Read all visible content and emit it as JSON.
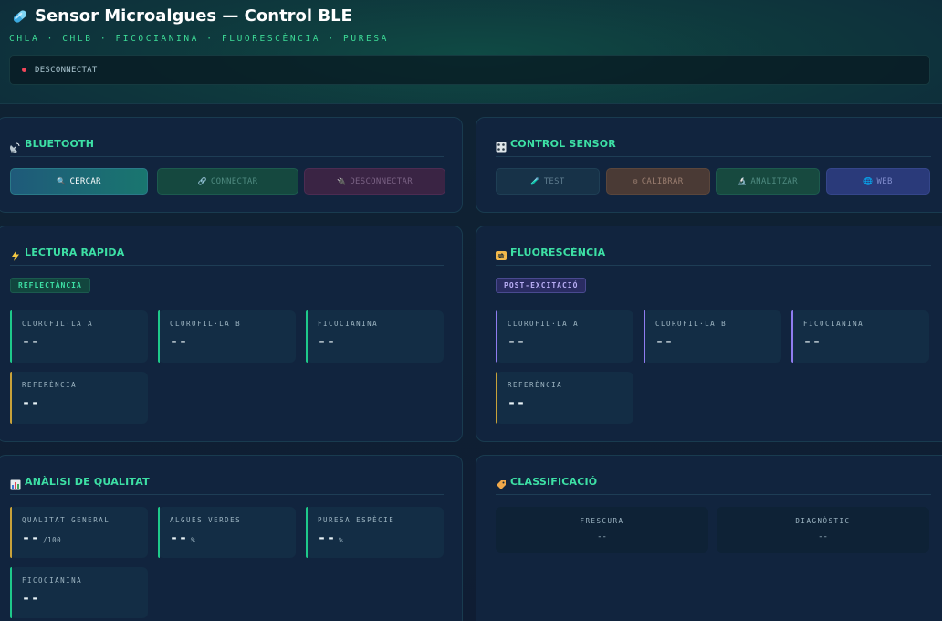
{
  "header": {
    "title": "Sensor Microalgues — Control BLE",
    "subtitle": "CHLA · CHLB · FICOCIANINA · FLUORESCÈNCIA · PURESA",
    "status": "DESCONNECTAT",
    "status_color": "#f0465a"
  },
  "bluetooth": {
    "title": "BLUETOOTH",
    "icon": "satellite-antenna-icon",
    "buttons": {
      "search": {
        "label": "CERCAR",
        "icon": "magnifier-icon"
      },
      "connect": {
        "label": "CONNECTAR",
        "icon": "link-icon"
      },
      "disconnect": {
        "label": "DESCONNECTAR",
        "icon": "unplug-icon"
      }
    }
  },
  "control": {
    "title": "CONTROL SENSOR",
    "icon": "control-knobs-icon",
    "buttons": {
      "test": {
        "label": "TEST",
        "icon": "test-tube-icon"
      },
      "calibrate": {
        "label": "CALIBRAR",
        "icon": "gear-icon"
      },
      "analyze": {
        "label": "ANALITZAR",
        "icon": "microscope-icon"
      },
      "web": {
        "label": "WEB",
        "icon": "globe-icon"
      }
    }
  },
  "quick": {
    "title": "LECTURA RÀPIDA",
    "icon": "lightning-icon",
    "tag": "REFLECTÀNCIA",
    "metrics": [
      {
        "label": "CLOROFIL·LA A",
        "value": "--"
      },
      {
        "label": "CLOROFIL·LA B",
        "value": "--"
      },
      {
        "label": "FICOCIANINA",
        "value": "--"
      },
      {
        "label": "REFERÈNCIA",
        "value": "--"
      }
    ]
  },
  "fluor": {
    "title": "FLUORESCÈNCIA",
    "icon": "arrows-cycle-icon",
    "tag": "POST-EXCITACIÓ",
    "metrics": [
      {
        "label": "CLOROFIL·LA A",
        "value": "--"
      },
      {
        "label": "CLOROFIL·LA B",
        "value": "--"
      },
      {
        "label": "FICOCIANINA",
        "value": "--"
      },
      {
        "label": "REFERÈNCIA",
        "value": "--"
      }
    ]
  },
  "quality": {
    "title": "ANÀLISI DE QUALITAT",
    "icon": "bar-chart-icon",
    "metrics": [
      {
        "label": "QUALITAT GENERAL",
        "value": "--",
        "unit": "/100"
      },
      {
        "label": "ALGUES VERDES",
        "value": "--",
        "unit": "%"
      },
      {
        "label": "PURESA ESPÈCIE",
        "value": "--",
        "unit": "%"
      },
      {
        "label": "FICOCIANINA",
        "value": "--",
        "unit": ""
      }
    ]
  },
  "classification": {
    "title": "CLASSIFICACIÓ",
    "icon": "label-tag-icon",
    "items": [
      {
        "label": "FRESCURA",
        "value": "--"
      },
      {
        "label": "DIAGNÒSTIC",
        "value": "--"
      }
    ]
  },
  "colors": {
    "accent": "#3de0a5",
    "green_bar": "#1ec98a",
    "gold_bar": "#c8a23a",
    "purple_bar": "#8f7cf0"
  }
}
